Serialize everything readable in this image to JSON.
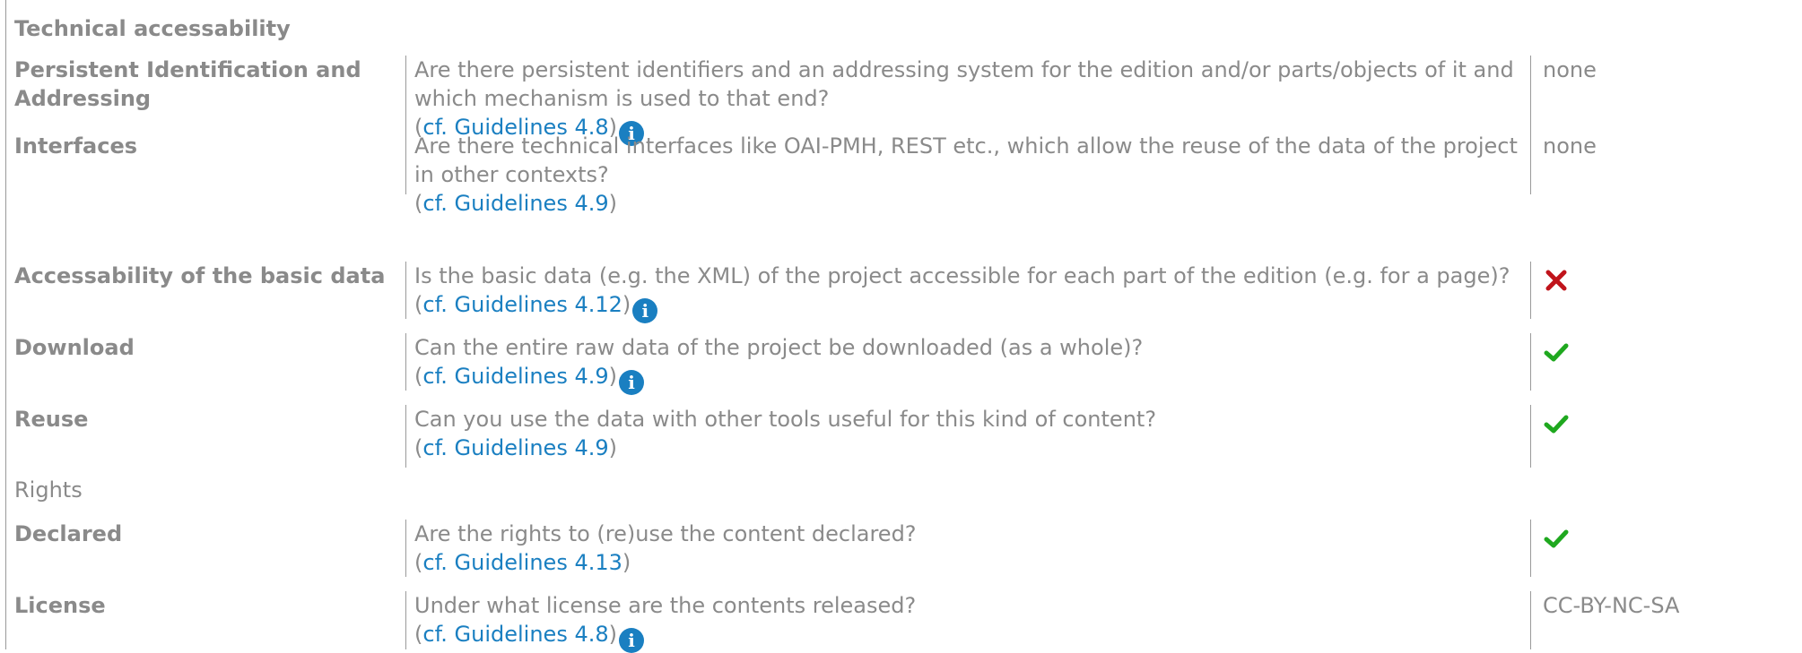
{
  "sections": {
    "technical": "Technical accessability",
    "rights": "Rights"
  },
  "cite_open": "(",
  "cite_close": ")",
  "rows": {
    "pid": {
      "label": "Persistent Identification and Addressing",
      "question": "Are there persistent identifiers and an addressing system for the edition and/or parts/objects of it and which mechanism is used to that end?",
      "link": "cf. Guidelines 4.8",
      "value": "none"
    },
    "interfaces": {
      "label": "Interfaces",
      "question": "Are there technical interfaces like OAI-PMH, REST etc., which allow the reuse of the data of the project in other contexts?",
      "link": "cf. Guidelines 4.9",
      "value": "none"
    },
    "basic_data": {
      "label": "Accessability of the basic data",
      "question": "Is the basic data (e.g. the XML) of the project accessible for each part of the edition (e.g. for a page)?",
      "link": "cf. Guidelines 4.12",
      "value_icon": "cross-icon"
    },
    "download": {
      "label": "Download",
      "question": "Can the entire raw data of the project be downloaded (as a whole)?",
      "link": "cf. Guidelines 4.9",
      "value_icon": "check-icon"
    },
    "reuse": {
      "label": "Reuse",
      "question": "Can you use the data with other tools useful for this kind of content?",
      "link": "cf. Guidelines 4.9",
      "value_icon": "check-icon"
    },
    "declared": {
      "label": "Declared",
      "question": "Are the rights to (re)use the content declared?",
      "link": "cf. Guidelines 4.13",
      "value_icon": "check-icon"
    },
    "license": {
      "label": "License",
      "question": "Under what license are the contents released?",
      "link": "cf. Guidelines 4.8",
      "value": "CC-BY-NC-SA"
    }
  },
  "icons": {
    "info": "info-icon",
    "info_glyph": "i",
    "check": "check-icon",
    "cross": "cross-icon"
  },
  "colors": {
    "text": "#8a8a8a",
    "link": "#1a7fc1",
    "check": "#1fa81f",
    "cross": "#c0141b",
    "rule": "#9a9a9a"
  }
}
